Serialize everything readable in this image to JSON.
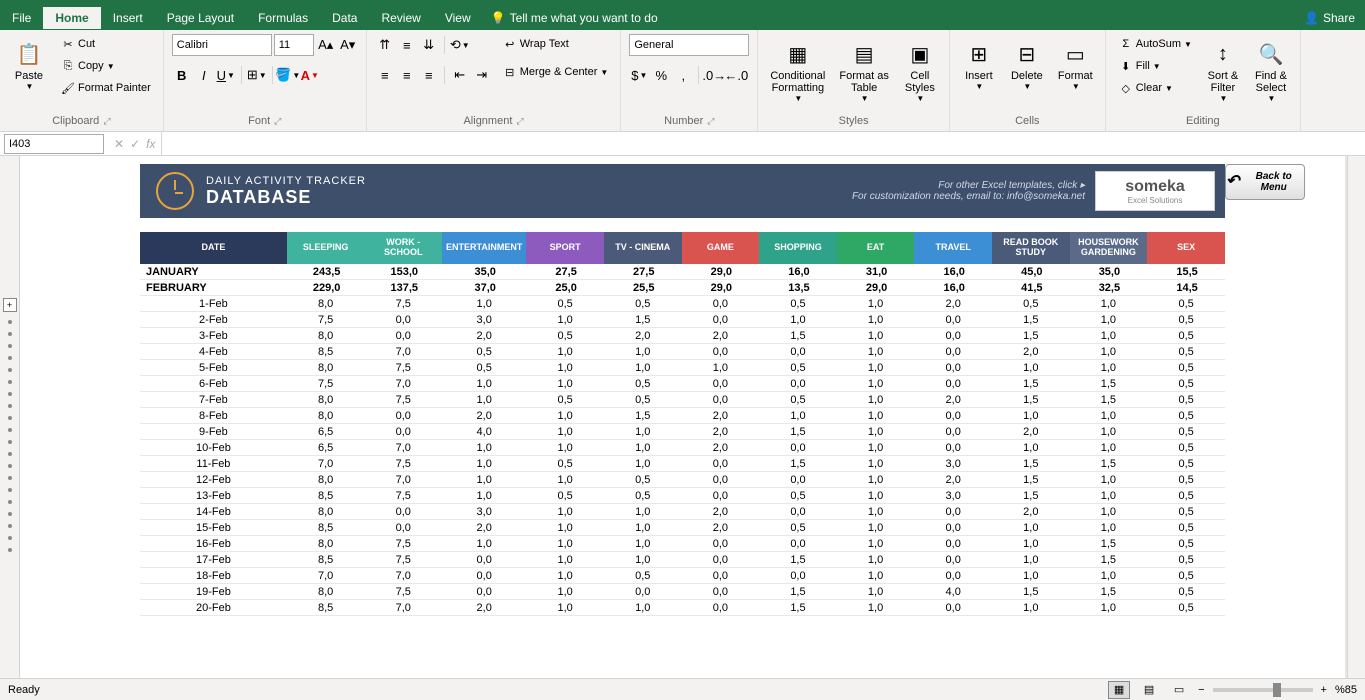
{
  "tabs": {
    "file": "File",
    "home": "Home",
    "insert": "Insert",
    "page_layout": "Page Layout",
    "formulas": "Formulas",
    "data": "Data",
    "review": "Review",
    "view": "View",
    "tell_me": "Tell me what you want to do",
    "share": "Share"
  },
  "ribbon": {
    "clipboard": {
      "label": "Clipboard",
      "paste": "Paste",
      "cut": "Cut",
      "copy": "Copy",
      "format_painter": "Format Painter"
    },
    "font": {
      "label": "Font",
      "name": "Calibri",
      "size": "11"
    },
    "alignment": {
      "label": "Alignment",
      "wrap": "Wrap Text",
      "merge": "Merge & Center"
    },
    "number": {
      "label": "Number",
      "format": "General"
    },
    "styles": {
      "label": "Styles",
      "conditional": "Conditional\nFormatting",
      "format_table": "Format as\nTable",
      "cell_styles": "Cell\nStyles"
    },
    "cells": {
      "label": "Cells",
      "insert": "Insert",
      "delete": "Delete",
      "format": "Format"
    },
    "editing": {
      "label": "Editing",
      "autosum": "AutoSum",
      "fill": "Fill",
      "clear": "Clear",
      "sort": "Sort &\nFilter",
      "find": "Find &\nSelect"
    }
  },
  "formula_bar": {
    "cell_ref": "I403",
    "fx": "fx",
    "value": ""
  },
  "template": {
    "title_label": "DAILY ACTIVITY TRACKER",
    "title_main": "DATABASE",
    "info1": "For other Excel templates, click ▸",
    "info2": "For customization needs, email to: info@someka.net",
    "logo_main": "someka",
    "logo_sub": "Excel Solutions",
    "back_label": "Back to Menu"
  },
  "headers": [
    "DATE",
    "SLEEPING",
    "WORK - SCHOOL",
    "ENTERTAINMENT",
    "SPORT",
    "TV - CINEMA",
    "GAME",
    "SHOPPING",
    "EAT",
    "TRAVEL",
    "READ BOOK STUDY",
    "HOUSEWORK GARDENING",
    "SEX"
  ],
  "months": [
    {
      "name": "JANUARY",
      "values": [
        "243,5",
        "153,0",
        "35,0",
        "27,5",
        "27,5",
        "29,0",
        "16,0",
        "31,0",
        "16,0",
        "45,0",
        "35,0",
        "15,5"
      ]
    },
    {
      "name": "FEBRUARY",
      "values": [
        "229,0",
        "137,5",
        "37,0",
        "25,0",
        "25,5",
        "29,0",
        "13,5",
        "29,0",
        "16,0",
        "41,5",
        "32,5",
        "14,5"
      ]
    }
  ],
  "rows": [
    {
      "d": "1-Feb",
      "v": [
        "8,0",
        "7,5",
        "1,0",
        "0,5",
        "0,5",
        "0,0",
        "0,5",
        "1,0",
        "2,0",
        "0,5",
        "1,0",
        "0,5"
      ]
    },
    {
      "d": "2-Feb",
      "v": [
        "7,5",
        "0,0",
        "3,0",
        "1,0",
        "1,5",
        "0,0",
        "1,0",
        "1,0",
        "0,0",
        "1,5",
        "1,0",
        "0,5"
      ]
    },
    {
      "d": "3-Feb",
      "v": [
        "8,0",
        "0,0",
        "2,0",
        "0,5",
        "2,0",
        "2,0",
        "1,5",
        "1,0",
        "0,0",
        "1,5",
        "1,0",
        "0,5"
      ]
    },
    {
      "d": "4-Feb",
      "v": [
        "8,5",
        "7,0",
        "0,5",
        "1,0",
        "1,0",
        "0,0",
        "0,0",
        "1,0",
        "0,0",
        "2,0",
        "1,0",
        "0,5"
      ]
    },
    {
      "d": "5-Feb",
      "v": [
        "8,0",
        "7,5",
        "0,5",
        "1,0",
        "1,0",
        "1,0",
        "0,5",
        "1,0",
        "0,0",
        "1,0",
        "1,0",
        "0,5"
      ]
    },
    {
      "d": "6-Feb",
      "v": [
        "7,5",
        "7,0",
        "1,0",
        "1,0",
        "0,5",
        "0,0",
        "0,0",
        "1,0",
        "0,0",
        "1,5",
        "1,5",
        "0,5"
      ]
    },
    {
      "d": "7-Feb",
      "v": [
        "8,0",
        "7,5",
        "1,0",
        "0,5",
        "0,5",
        "0,0",
        "0,5",
        "1,0",
        "2,0",
        "1,5",
        "1,5",
        "0,5"
      ]
    },
    {
      "d": "8-Feb",
      "v": [
        "8,0",
        "0,0",
        "2,0",
        "1,0",
        "1,5",
        "2,0",
        "1,0",
        "1,0",
        "0,0",
        "1,0",
        "1,0",
        "0,5"
      ]
    },
    {
      "d": "9-Feb",
      "v": [
        "6,5",
        "0,0",
        "4,0",
        "1,0",
        "1,0",
        "2,0",
        "1,5",
        "1,0",
        "0,0",
        "2,0",
        "1,0",
        "0,5"
      ]
    },
    {
      "d": "10-Feb",
      "v": [
        "6,5",
        "7,0",
        "1,0",
        "1,0",
        "1,0",
        "2,0",
        "0,0",
        "1,0",
        "0,0",
        "1,0",
        "1,0",
        "0,5"
      ]
    },
    {
      "d": "11-Feb",
      "v": [
        "7,0",
        "7,5",
        "1,0",
        "0,5",
        "1,0",
        "0,0",
        "1,5",
        "1,0",
        "3,0",
        "1,5",
        "1,5",
        "0,5"
      ]
    },
    {
      "d": "12-Feb",
      "v": [
        "8,0",
        "7,0",
        "1,0",
        "1,0",
        "0,5",
        "0,0",
        "0,0",
        "1,0",
        "2,0",
        "1,5",
        "1,0",
        "0,5"
      ]
    },
    {
      "d": "13-Feb",
      "v": [
        "8,5",
        "7,5",
        "1,0",
        "0,5",
        "0,5",
        "0,0",
        "0,5",
        "1,0",
        "3,0",
        "1,5",
        "1,0",
        "0,5"
      ]
    },
    {
      "d": "14-Feb",
      "v": [
        "8,0",
        "0,0",
        "3,0",
        "1,0",
        "1,0",
        "2,0",
        "0,0",
        "1,0",
        "0,0",
        "2,0",
        "1,0",
        "0,5"
      ]
    },
    {
      "d": "15-Feb",
      "v": [
        "8,5",
        "0,0",
        "2,0",
        "1,0",
        "1,0",
        "2,0",
        "0,5",
        "1,0",
        "0,0",
        "1,0",
        "1,0",
        "0,5"
      ]
    },
    {
      "d": "16-Feb",
      "v": [
        "8,0",
        "7,5",
        "1,0",
        "1,0",
        "1,0",
        "0,0",
        "0,0",
        "1,0",
        "0,0",
        "1,0",
        "1,5",
        "0,5"
      ]
    },
    {
      "d": "17-Feb",
      "v": [
        "8,5",
        "7,5",
        "0,0",
        "1,0",
        "1,0",
        "0,0",
        "1,5",
        "1,0",
        "0,0",
        "1,0",
        "1,5",
        "0,5"
      ]
    },
    {
      "d": "18-Feb",
      "v": [
        "7,0",
        "7,0",
        "0,0",
        "1,0",
        "0,5",
        "0,0",
        "0,0",
        "1,0",
        "0,0",
        "1,0",
        "1,0",
        "0,5"
      ]
    },
    {
      "d": "19-Feb",
      "v": [
        "8,0",
        "7,5",
        "0,0",
        "1,0",
        "0,0",
        "0,0",
        "1,5",
        "1,0",
        "4,0",
        "1,5",
        "1,5",
        "0,5"
      ]
    },
    {
      "d": "20-Feb",
      "v": [
        "8,5",
        "7,0",
        "2,0",
        "1,0",
        "1,0",
        "0,0",
        "1,5",
        "1,0",
        "0,0",
        "1,0",
        "1,0",
        "0,5"
      ]
    }
  ],
  "status": {
    "ready": "Ready",
    "zoom": "%85"
  }
}
